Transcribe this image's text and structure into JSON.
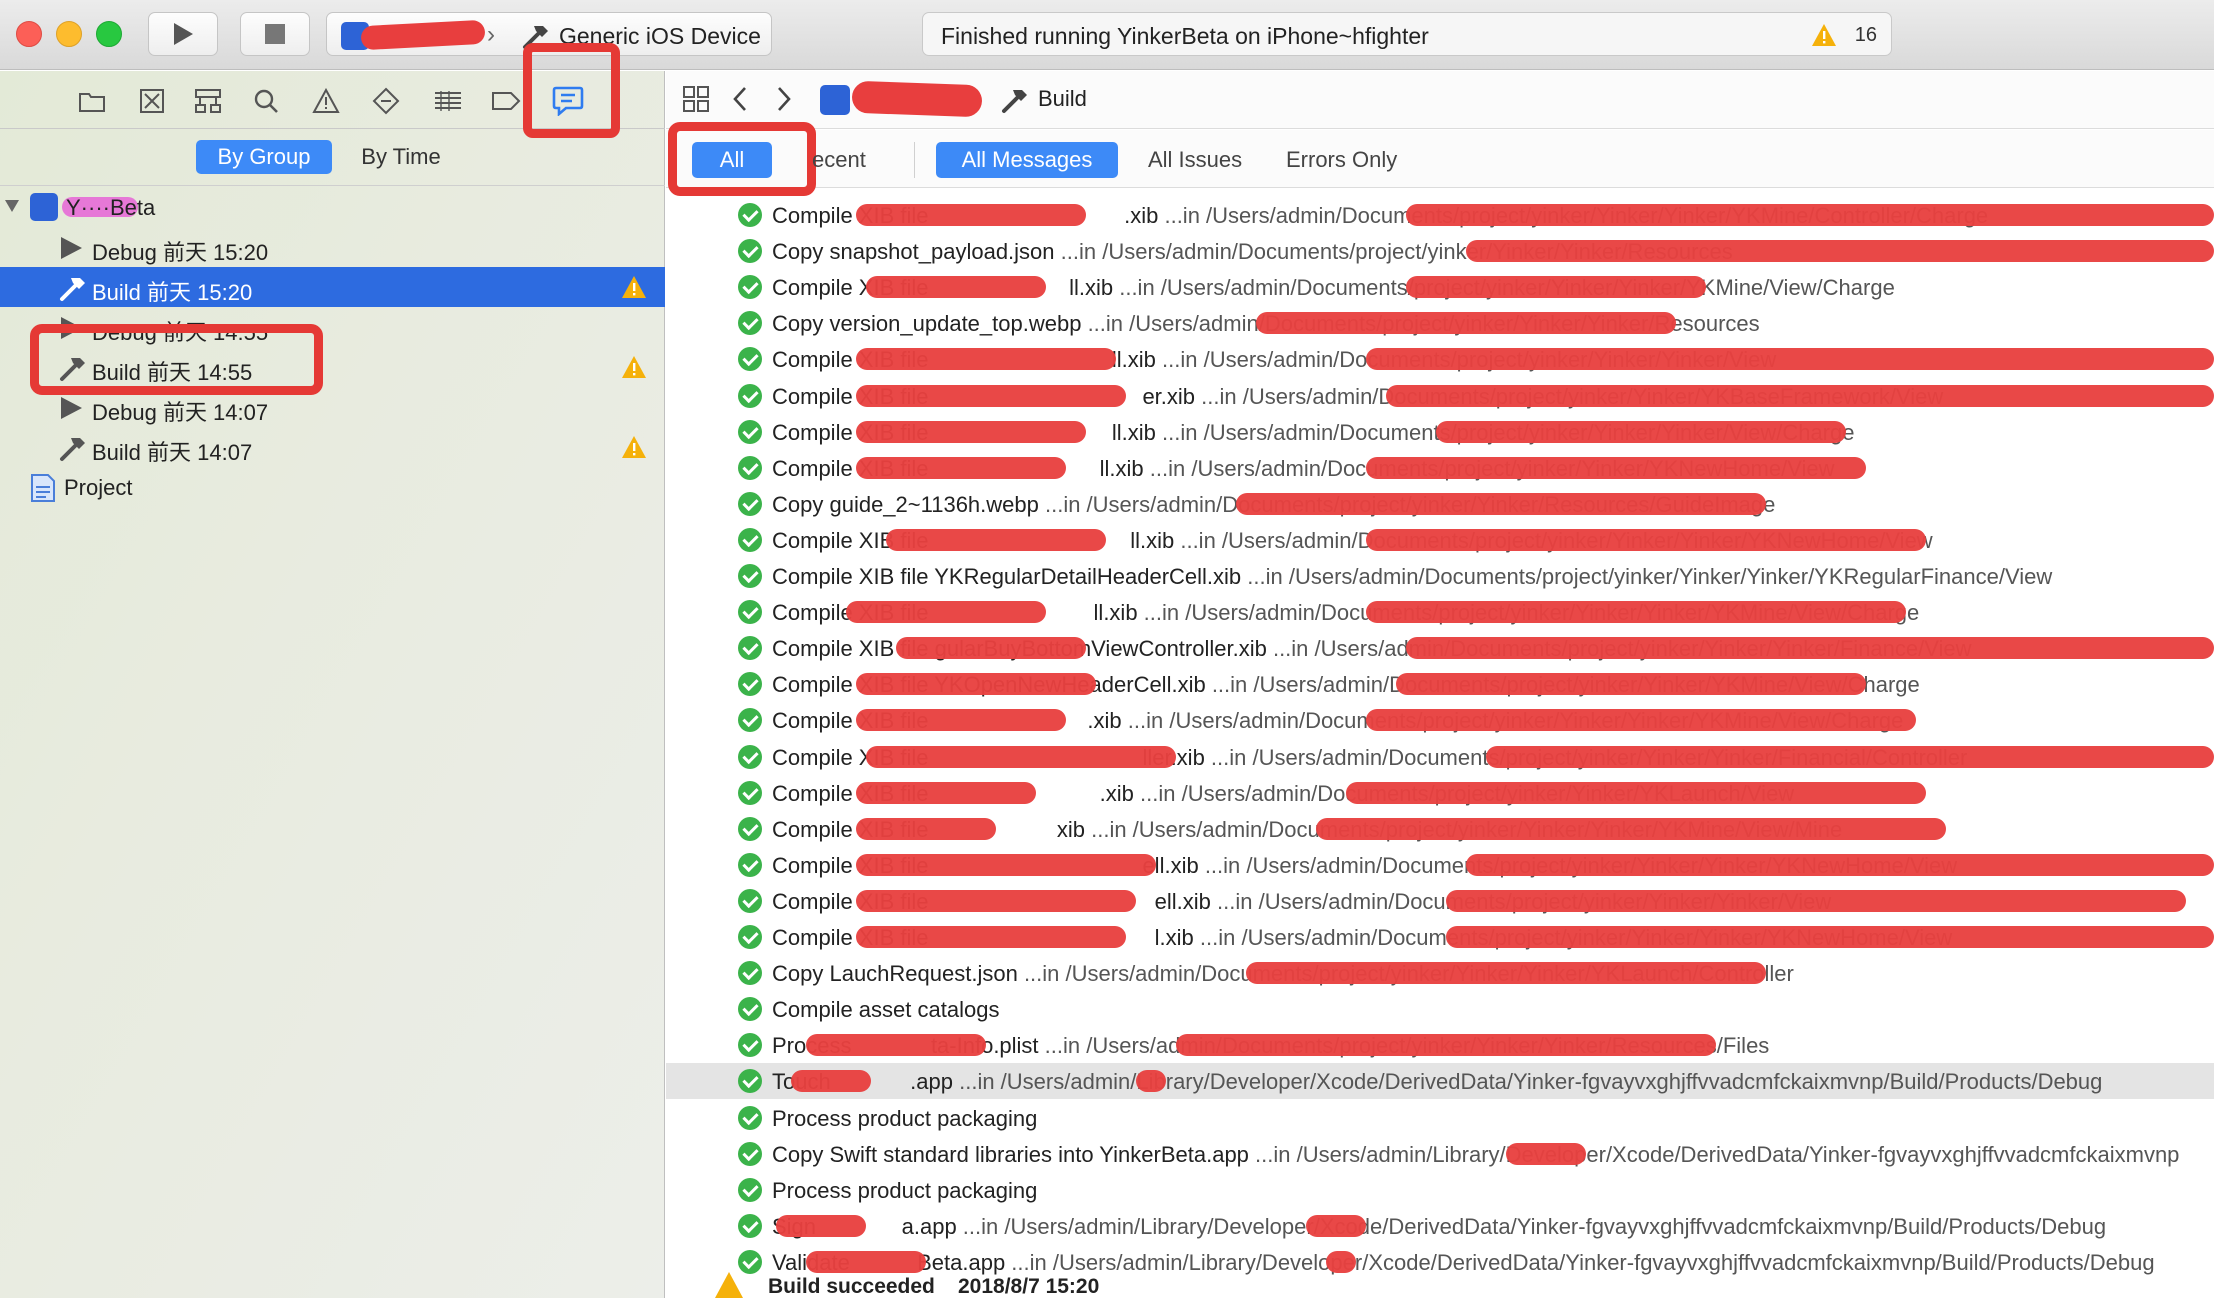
{
  "toolbar": {
    "scheme_device": "Generic iOS Device",
    "activity_text": "Finished running YinkerBeta on iPhone~hfighter",
    "warning_count": "16"
  },
  "navigator": {
    "filters": {
      "by_group": "By Group",
      "by_time": "By Time"
    },
    "root_label": "Y····Beta",
    "items": [
      {
        "icon": "play-icon",
        "label": "Debug 前天 15:20",
        "warning": false
      },
      {
        "icon": "hammer-icon",
        "label": "Build 前天 15:20",
        "warning": true,
        "selected": true
      },
      {
        "icon": "play-icon",
        "label": "Debug 前天 14:55",
        "warning": false
      },
      {
        "icon": "hammer-icon",
        "label": "Build 前天 14:55",
        "warning": true
      },
      {
        "icon": "play-icon",
        "label": "Debug 前天 14:07",
        "warning": false
      },
      {
        "icon": "hammer-icon",
        "label": "Build 前天 14:07",
        "warning": true
      }
    ],
    "project_label": "Project"
  },
  "editor": {
    "breadcrumb": "Build",
    "filters": {
      "all": "All",
      "recent": "ecent",
      "all_messages": "All Messages",
      "all_issues": "All Issues",
      "errors_only": "Errors Only"
    },
    "log_rows": [
      {
        "title": "Compile XIB file",
        "detail": "                                .xib",
        "path": " ...in /Users/admin/Documents/project/yinker/Yinker/Yinker/YKMine/Controller/Charge"
      },
      {
        "title": "Copy snapshot_payload.json",
        "detail": "",
        "path": " ...in /Users/admin/Documents/project/yinker/Yinker/Yinker/Resources"
      },
      {
        "title": "Compile XIB file",
        "detail": "                       ll.xib",
        "path": " ...in /Users/admin/Documents/project/yinker/Yinker/Yinker/YKMine/View/Charge"
      },
      {
        "title": "Copy version_update_top.webp",
        "detail": "",
        "path": " ...in /Users/admin/Documents/project/yinker/Yinker/Yinker/Resources"
      },
      {
        "title": "Compile XIB file",
        "detail": "                              ll.xib",
        "path": " ...in /Users/admin/Documents/project/yinker/Yinker/Yinker/View"
      },
      {
        "title": "Compile XIB file",
        "detail": "                                   er.xib",
        "path": " ...in /Users/admin/Documents/project/yinker/Yinker/YKBaseFramework/View"
      },
      {
        "title": "Compile XIB file",
        "detail": "                              ll.xib",
        "path": " ...in /Users/admin/Documents/project/yinker/Yinker/Yinker/View/Charge"
      },
      {
        "title": "Compile XIB file",
        "detail": "                            ll.xib",
        "path": " ...in /Users/admin/Documents/project/yinker/Yinker/YKNewHome/View"
      },
      {
        "title": "Copy guide_2~1136h.webp",
        "detail": "",
        "path": " ...in /Users/admin/Documents/project/yinker/Yinker/Resources/GuideImage"
      },
      {
        "title": "Compile XIB file",
        "detail": "                                 ll.xib",
        "path": " ...in /Users/admin/Documents/project/yinker/Yinker/Yinker/YKNewHome/View"
      },
      {
        "title": "Compile XIB file",
        "detail": " YKRegularDetailHeaderCell.xib",
        "path": " ...in /Users/admin/Documents/project/yinker/Yinker/Yinker/YKRegularFinance/View"
      },
      {
        "title": "Compile XIB file",
        "detail": "                           ll.xib",
        "path": " ...in /Users/admin/Documents/project/yinker/Yinker/Yinker/YKMine/View/Charge"
      },
      {
        "title": "Compile XIB file",
        "detail": " gularBuyBottomViewController.xib",
        "path": " ...in /Users/admin/Documents/project/yinker/Yinker/Yinker/Finance/View"
      },
      {
        "title": "Compile XIB file",
        "detail": " YKOpenNewHeaderCell.xib",
        "path": " ...in /Users/admin/Documents/project/yinker/Yinker/YKMine/View/Charge"
      },
      {
        "title": "Compile XIB file",
        "detail": "                          .xib",
        "path": " ...in /Users/admin/Documents/project/yinker/Yinker/Yinker/YKMine/View/Charge"
      },
      {
        "title": "Compile XIB file",
        "detail": "                                   ller.xib",
        "path": " ...in /Users/admin/Documents/project/yinker/Yinker/Yinker/Financial/Controller"
      },
      {
        "title": "Compile XIB file",
        "detail": "                            .xib",
        "path": " ...in /Users/admin/Documents/project/yinker/Yinker/YKLaunch/View"
      },
      {
        "title": "Compile XIB file",
        "detail": "                     xib",
        "path": " ...in /Users/admin/Documents/project/yinker/Yinker/Yinker/YKMine/View/Mine"
      },
      {
        "title": "Compile XIB file",
        "detail": "                                   ell.xib",
        "path": " ...in /Users/admin/Documents/project/yinker/Yinker/Yinker/YKNewHome/View"
      },
      {
        "title": "Compile XIB file",
        "detail": "                                     ell.xib",
        "path": " ...in /Users/admin/Documents/project/yinker/Yinker/Yinker/View"
      },
      {
        "title": "Compile XIB file",
        "detail": "                                     l.xib",
        "path": " ...in /Users/admin/Documents/project/yinker/Yinker/Yinker/YKNewHome/View"
      },
      {
        "title": "Copy LauchRequest.json",
        "detail": "",
        "path": " ...in /Users/admin/Documents/project/yinker/Yinker/Yinker/YKLaunch/Controller"
      },
      {
        "title": "Compile asset catalogs",
        "detail": "",
        "path": ""
      },
      {
        "title": "Process",
        "detail": "             ta-Info.plist",
        "path": " ...in /Users/admin/Documents/project/yinker/Yinker/Yinker/Resources/Files"
      },
      {
        "title": "Touch",
        "detail": "             .app",
        "path": " ...in /Users/admin/Library/Developer/Xcode/DerivedData/Yinker-fgvayvxghjffvvadcmfckaixmvnp/Build/Products/Debug"
      },
      {
        "title": "Process product packaging",
        "detail": "",
        "path": ""
      },
      {
        "title": "Copy Swift standard libraries into YinkerBeta.app",
        "detail": "",
        "path": " ...in /Users/admin/Library/Developer/Xcode/DerivedData/Yinker-fgvayvxghjffvvadcmfckaixmvnp"
      },
      {
        "title": "Process product packaging",
        "detail": "",
        "path": ""
      },
      {
        "title": "Sign",
        "detail": "              a.app",
        "path": " ...in /Users/admin/Library/Developer/Xcode/DerivedData/Yinker-fgvayvxghjffvvadcmfckaixmvnp/Build/Products/Debug"
      },
      {
        "title": "Validate",
        "detail": "           Beta.app",
        "path": " ...in /Users/admin/Library/Developer/Xcode/DerivedData/Yinker-fgvayvxghjffvvadcmfckaixmvnp/Build/Products/Debug"
      }
    ],
    "summary": {
      "status": "Build succeeded",
      "time": "2018/8/7 15:20"
    }
  },
  "colors": {
    "accent": "#3d8af7",
    "selection": "#2d6be0",
    "highlight_box": "#e53935",
    "success": "#3bb34a",
    "warning": "#f5b10a"
  }
}
